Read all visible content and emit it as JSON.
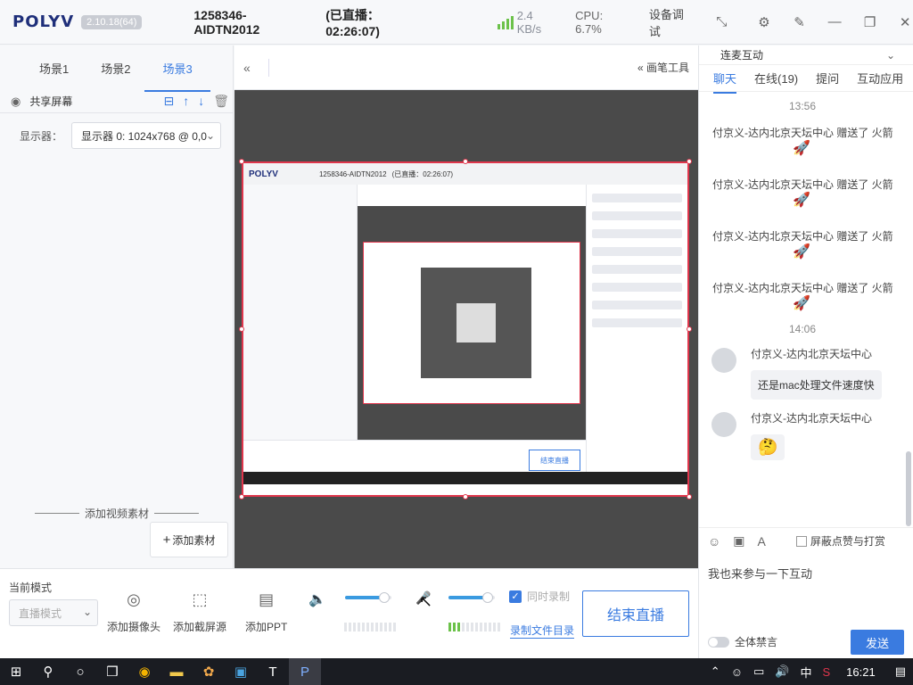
{
  "titlebar": {
    "logo": "POLYV",
    "version": "2.10.18(64)",
    "room_id": "1258346-AIDTN2012",
    "live_status": "(已直播：02:26:07)",
    "net_speed": "2.4 KB/s",
    "cpu": "CPU: 6.7%",
    "device_test": "设备调试",
    "icons": [
      "collapse-icon",
      "settings-icon",
      "pin-icon",
      "minimize-icon",
      "restore-icon",
      "close-icon"
    ]
  },
  "scenes": {
    "tabs": [
      "场景1",
      "场景2",
      "场景3"
    ],
    "active_tab": "场景3",
    "source_name": "共享屏幕",
    "display_label": "显示器：",
    "display_value": "显示器 0: 1024x768 @ 0,0",
    "add_video_title": "添加视频素材",
    "add_material": "添加素材"
  },
  "center": {
    "draw_tool": "画笔工具",
    "preview": {
      "title_room": "1258346-AIDTN2012",
      "title_live": "(已直播：02:26:07)",
      "end_btn": "结束直播"
    }
  },
  "chat": {
    "interact_title": "连麦互动",
    "tabs": [
      "聊天",
      "在线(19)",
      "提问",
      "互动应用"
    ],
    "active_tab": "聊天",
    "time1": "13:56",
    "gifts": [
      "付京义-达内北京天坛中心 赠送了 火箭",
      "付京义-达内北京天坛中心 赠送了 火箭",
      "付京义-达内北京天坛中心 赠送了 火箭",
      "付京义-达内北京天坛中心 赠送了 火箭"
    ],
    "time2": "14:06",
    "messages": [
      {
        "name": "付京义-达内北京天坛中心",
        "text": "还是mac处理文件速度快"
      },
      {
        "name": "付京义-达内北京天坛中心",
        "text": "🤔"
      }
    ],
    "block_label": "屏蔽点赞与打赏",
    "input_text": "我也来参与一下互动",
    "mute_all": "全体禁言",
    "send": "发送"
  },
  "bottom": {
    "mode_label": "当前模式",
    "mode_value": "直播模式",
    "tools": [
      "添加摄像头",
      "添加截屏源",
      "添加PPT"
    ],
    "volume_level": 0.85,
    "mic_level": 0.85,
    "sync_record": "同时录制",
    "record_dir": "录制文件目录",
    "end_live": "结束直播"
  },
  "taskbar": {
    "clock": "16:21",
    "ime": "中",
    "apps": [
      "windows-start-icon",
      "search-icon",
      "cortana-icon",
      "task-view-icon",
      "chrome-icon",
      "file-explorer-icon",
      "paint-icon",
      "app-icon",
      "typora-icon",
      "polyv-icon"
    ]
  },
  "colors": {
    "accent": "#3a7be0",
    "preview_border": "#e0364c",
    "signal": "#6cc24a"
  }
}
